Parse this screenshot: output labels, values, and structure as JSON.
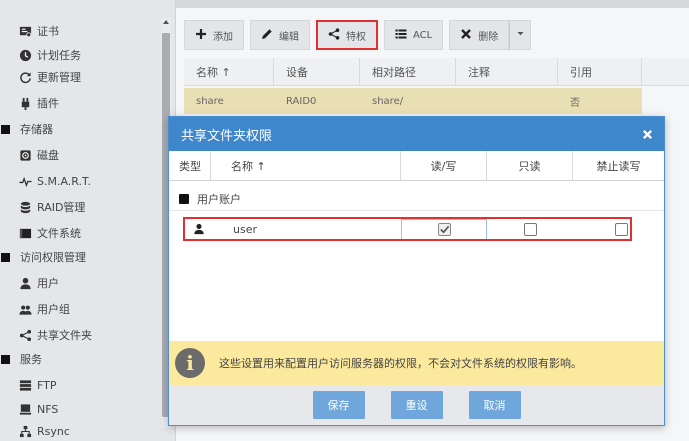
{
  "sidebar": {
    "items": [
      {
        "label": "证书",
        "icon": "certificate-icon"
      },
      {
        "label": "计划任务",
        "icon": "clock-icon"
      },
      {
        "label": "更新管理",
        "icon": "refresh-icon"
      },
      {
        "label": "插件",
        "icon": "plugin-icon"
      },
      {
        "label": "存储器",
        "icon": "group-icon"
      },
      {
        "label": "磁盘",
        "icon": "disk-icon"
      },
      {
        "label": "S.M.A.R.T.",
        "icon": "pulse-icon"
      },
      {
        "label": "RAID管理",
        "icon": "database-icon"
      },
      {
        "label": "文件系统",
        "icon": "folder-icon"
      },
      {
        "label": "访问权限管理",
        "icon": "group-icon"
      },
      {
        "label": "用户",
        "icon": "user-icon"
      },
      {
        "label": "用户组",
        "icon": "users-icon"
      },
      {
        "label": "共享文件夹",
        "icon": "share-icon"
      },
      {
        "label": "服务",
        "icon": "group-icon"
      },
      {
        "label": "FTP",
        "icon": "server-icon"
      },
      {
        "label": "NFS",
        "icon": "desktop-icon"
      },
      {
        "label": "Rsync",
        "icon": "sitemap-icon"
      }
    ]
  },
  "toolbar": {
    "add_label": "添加",
    "edit_label": "编辑",
    "privilege_label": "特权",
    "acl_label": "ACL",
    "delete_label": "删除"
  },
  "grid": {
    "columns": [
      "名称 ↑",
      "设备",
      "相对路径",
      "注释",
      "引用"
    ],
    "rows": [
      {
        "name": "share",
        "device": "RAID0",
        "path": "share/",
        "comment": "",
        "ref": "否"
      }
    ]
  },
  "dialog": {
    "title": "共享文件夹权限",
    "columns": {
      "type": "类型",
      "name": "名称 ↑",
      "rw": "读/写",
      "ro": "只读",
      "deny": "禁止读写"
    },
    "group_label": "用户账户",
    "user": {
      "name": "user",
      "rw": true,
      "ro": false,
      "deny": false
    },
    "info_text": "这些设置用来配置用户访问服务器的权限，不会对文件系统的权限有影响。",
    "buttons": {
      "save": "保存",
      "reset": "重设",
      "cancel": "取消"
    }
  },
  "colors": {
    "title_bar": "#3f87cc",
    "button": "#6fa6dc",
    "selected_row": "#e9dfb4",
    "info_bar": "#fbe99e",
    "highlight": "#e03030"
  }
}
